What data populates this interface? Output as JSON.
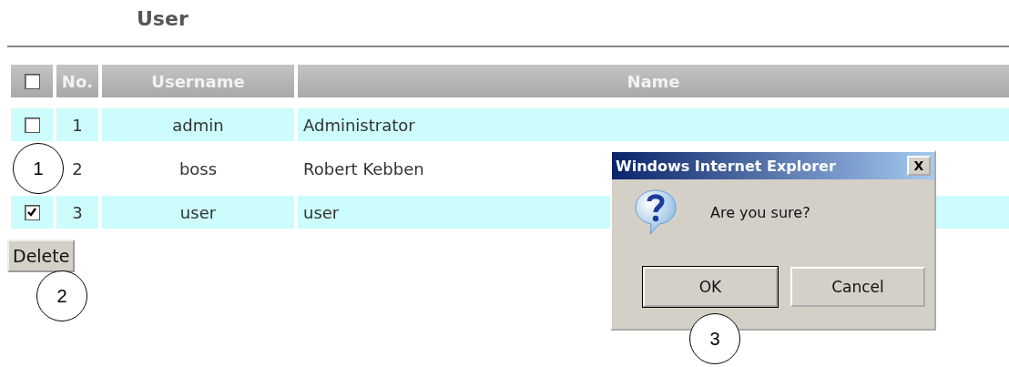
{
  "page": {
    "title": "User"
  },
  "table": {
    "select_all": {
      "checked": false
    },
    "columns": [
      "No.",
      "Username",
      "Name"
    ],
    "rows": [
      {
        "checked": false,
        "no": "1",
        "username": "admin",
        "name": "Administrator"
      },
      {
        "no": "2",
        "username": "boss",
        "name": "Robert Kebben"
      },
      {
        "checked": true,
        "no": "3",
        "username": "user",
        "name": "user"
      }
    ]
  },
  "delete_button": "Delete",
  "dialog": {
    "title": "Windows Internet Explorer",
    "close": "X",
    "message": "Are you sure?",
    "buttons": [
      "OK",
      "Cancel"
    ]
  },
  "callouts": [
    "1",
    "2",
    "3"
  ]
}
